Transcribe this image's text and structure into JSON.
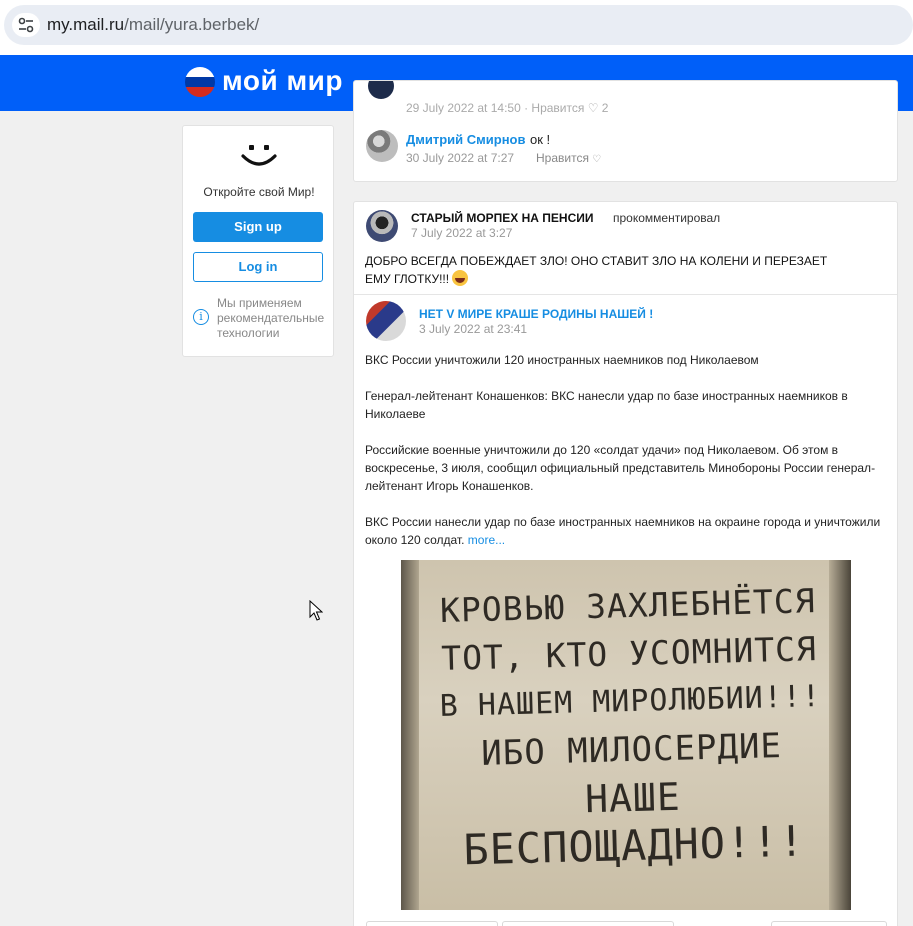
{
  "browser": {
    "url_host": "my.mail.ru",
    "url_path": "/mail/yura.berbek/"
  },
  "header": {
    "logo_text": "мой мир",
    "flag_colors": [
      "#ffffff",
      "#0039a6",
      "#d52b1e"
    ],
    "background_color": "#005ff9"
  },
  "promo": {
    "text": "Откройте свой Мир!",
    "signup_label": "Sign up",
    "login_label": "Log in",
    "info_line1": "Мы применяем",
    "info_line2": "рекомендательные",
    "info_line3": "технологии"
  },
  "top_card": {
    "clipped_date": "29 July 2022 at 14:50 · Нравится ♡ 2",
    "comment": {
      "author": "Дмитрий Смирнов",
      "text": "ок !",
      "date": "30 July 2022 at 7:27",
      "like_label": "Нравится"
    }
  },
  "feed_item": {
    "actor": "СТАРЫЙ МОРПЕХ НА ПЕНСИИ",
    "action": "прокомментировал",
    "date": "7 July 2022 at 3:27",
    "comment_line1": "ДОБРО ВСЕГДА ПОБЕЖДАЕТ ЗЛО! ОНО СТАВИТ ЗЛО НА КОЛЕНИ И ПЕРЕЗАЕТ",
    "comment_line2": "ЕМУ ГЛОТКУ!!!",
    "post": {
      "group_name": "НЕТ V МИРЕ КРАШЕ РОДИНЫ НАШЕЙ !",
      "date": "3 July 2022 at 23:41",
      "paragraph1": "ВКС России уничтожили 120 иностранных наемников под Николаевом",
      "paragraph2": "Генерал-лейтенант Конашенков: ВКС нанесли удар по базе иностранных наемников в Николаеве",
      "paragraph3": "Российские военные уничтожили до 120 «солдат удачи» под Николаевом. Об этом в воскресенье, 3 июля, сообщил официальный представитель Минобороны России генерал-лейтенант Игорь Конашенков.",
      "paragraph4": "ВКС России нанесли удар по базе иностранных наемников на окраине города и уничтожили около 120 солдат.",
      "more_label": "more...",
      "image_text": [
        "КРОВЬЮ ЗАХЛЕБНЁТСЯ",
        "ТОТ, КТО УСОМНИТСЯ",
        "В НАШЕМ МИРОЛЮБИИ!!!",
        "ИБО МИЛОСЕРДИЕ",
        "НАШЕ",
        "БЕСПОЩАДНО!!!"
      ]
    }
  },
  "colors": {
    "accent": "#168de2",
    "page_bg": "#f0f0f0"
  }
}
